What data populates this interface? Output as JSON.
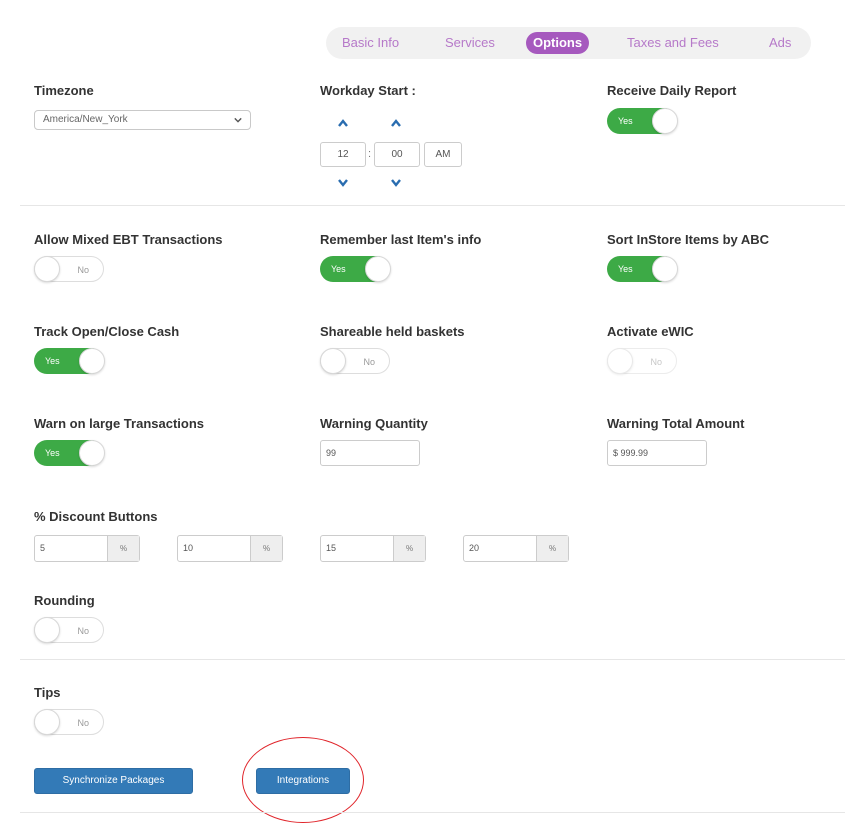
{
  "tabs": [
    {
      "label": "Basic Info",
      "active": false
    },
    {
      "label": "Services",
      "active": false
    },
    {
      "label": "Options",
      "active": true
    },
    {
      "label": "Taxes and Fees",
      "active": false
    },
    {
      "label": "Ads",
      "active": false
    }
  ],
  "timezone": {
    "label": "Timezone",
    "value": "America/New_York"
  },
  "workday_start": {
    "label": "Workday Start :",
    "hour": "12",
    "minute": "00",
    "meridian": "AM",
    "separator": ":"
  },
  "receive_daily_report": {
    "label": "Receive Daily Report",
    "state": "Yes"
  },
  "allow_mixed_ebt": {
    "label": "Allow Mixed EBT Transactions",
    "state": "No"
  },
  "remember_last_item": {
    "label": "Remember last Item's info",
    "state": "Yes"
  },
  "sort_instore": {
    "label": "Sort InStore Items by ABC",
    "state": "Yes"
  },
  "track_open_close": {
    "label": "Track Open/Close Cash",
    "state": "Yes"
  },
  "shareable_baskets": {
    "label": "Shareable held baskets",
    "state": "No"
  },
  "activate_ewic": {
    "label": "Activate eWIC",
    "state": "No"
  },
  "warn_large": {
    "label": "Warn on large Transactions",
    "state": "Yes"
  },
  "warning_quantity": {
    "label": "Warning Quantity",
    "value": "99"
  },
  "warning_total": {
    "label": "Warning Total Amount",
    "value": "$ 999.99"
  },
  "discount_buttons": {
    "label": "% Discount Buttons",
    "addon": "%",
    "values": [
      "5",
      "10",
      "15",
      "20"
    ]
  },
  "rounding": {
    "label": "Rounding",
    "state": "No"
  },
  "tips": {
    "label": "Tips",
    "state": "No"
  },
  "buttons": {
    "synchronize": "Synchronize Packages",
    "integrations": "Integrations"
  },
  "colors": {
    "accent": "#a659be",
    "toggle_on": "#3daa46",
    "primary_button": "#337ab7",
    "annotation": "#e0242a"
  }
}
